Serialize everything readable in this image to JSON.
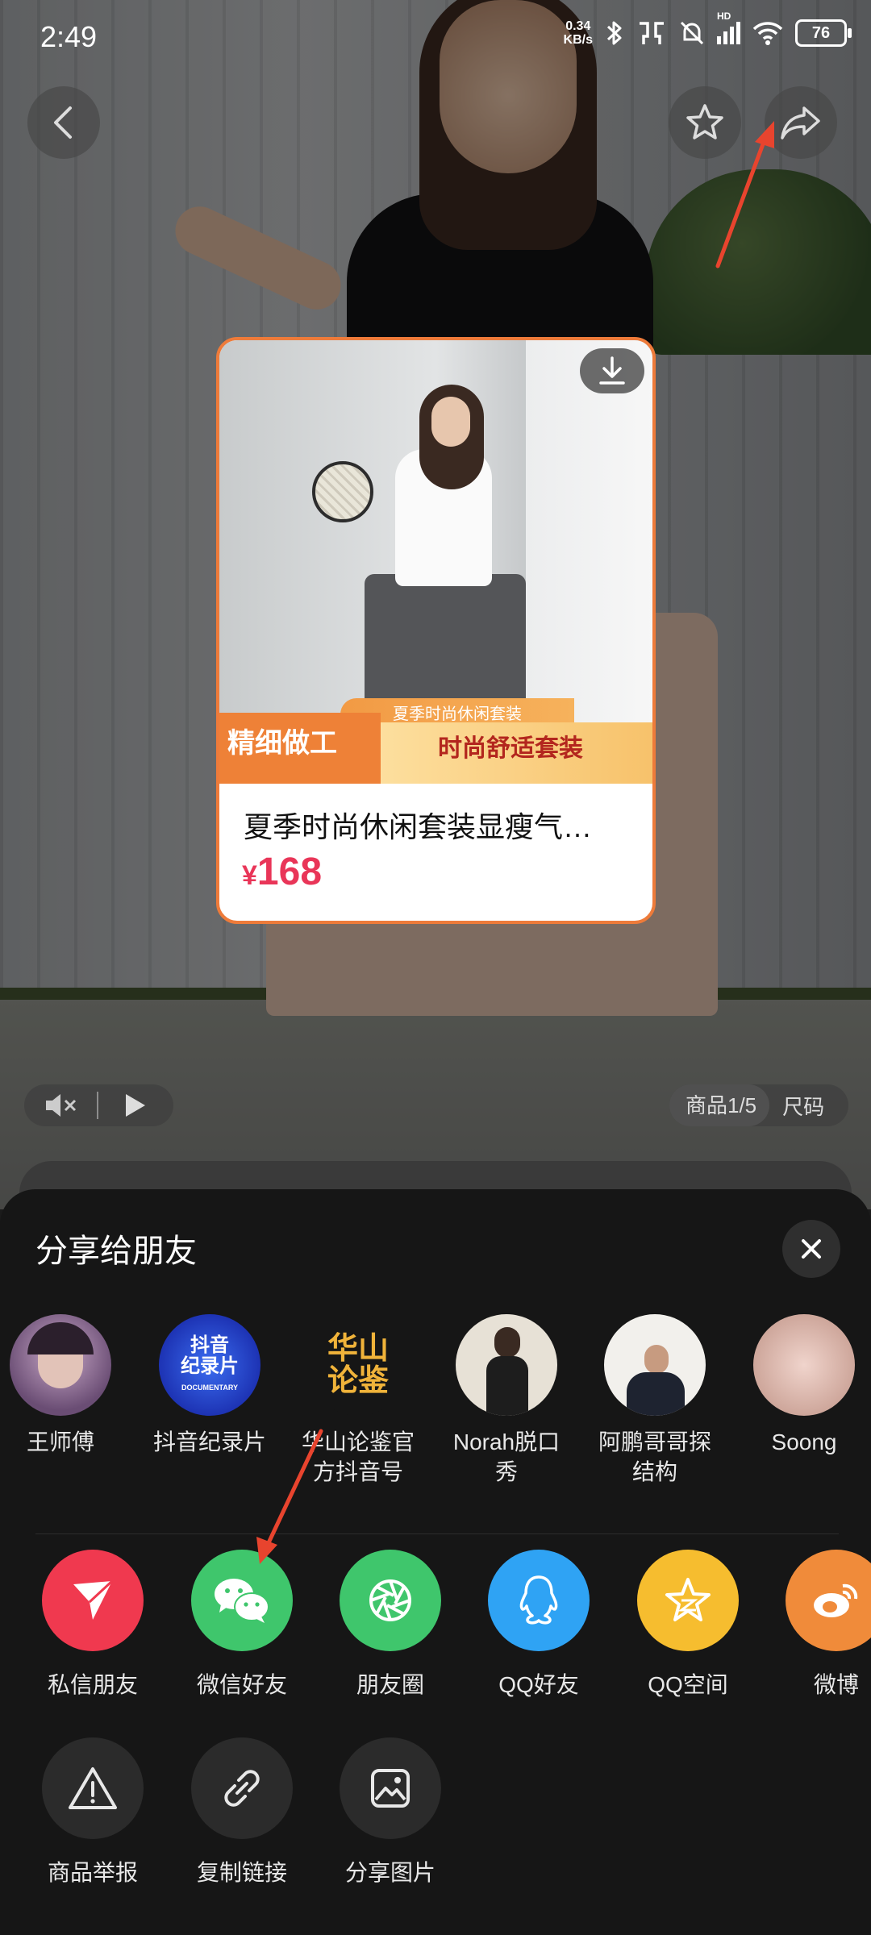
{
  "status_bar": {
    "time": "2:49",
    "net_speed_value": "0.34",
    "net_speed_unit": "KB/s",
    "hd_label": "HD",
    "battery": "76"
  },
  "product_card": {
    "banner_top": "夏季时尚休闲套装",
    "banner_left": "精细做工",
    "banner_right": "时尚舒适套装",
    "title": "夏季时尚休闲套装显瘦气…",
    "price_symbol": "¥",
    "price": "168"
  },
  "product_pager": {
    "page": "商品1/5",
    "size": "尺码"
  },
  "share_sheet": {
    "title": "分享给朋友",
    "friends": [
      {
        "name": "王师傅"
      },
      {
        "name": "抖音纪录片",
        "avatar_text_1": "抖音",
        "avatar_text_2": "纪录片",
        "avatar_text_3": "DOCUMENTARY"
      },
      {
        "name": "华山论鉴官方抖音号",
        "avatar_text_1": "华山",
        "avatar_text_2": "论鉴"
      },
      {
        "name": "Norah脱口秀"
      },
      {
        "name": "阿鹏哥哥探结构"
      },
      {
        "name": "Soong"
      }
    ],
    "apps": [
      {
        "label": "私信朋友",
        "color": "#f0394f"
      },
      {
        "label": "微信好友",
        "color": "#3fc66c"
      },
      {
        "label": "朋友圈",
        "color": "#3fc66c"
      },
      {
        "label": "QQ好友",
        "color": "#2fa3f4"
      },
      {
        "label": "QQ空间",
        "color": "#f6bd2f"
      },
      {
        "label": "微博",
        "color": "#f08b3a"
      }
    ],
    "tools": [
      {
        "label": "商品举报"
      },
      {
        "label": "复制链接"
      },
      {
        "label": "分享图片"
      }
    ]
  },
  "annotation_color": "#e8442e"
}
